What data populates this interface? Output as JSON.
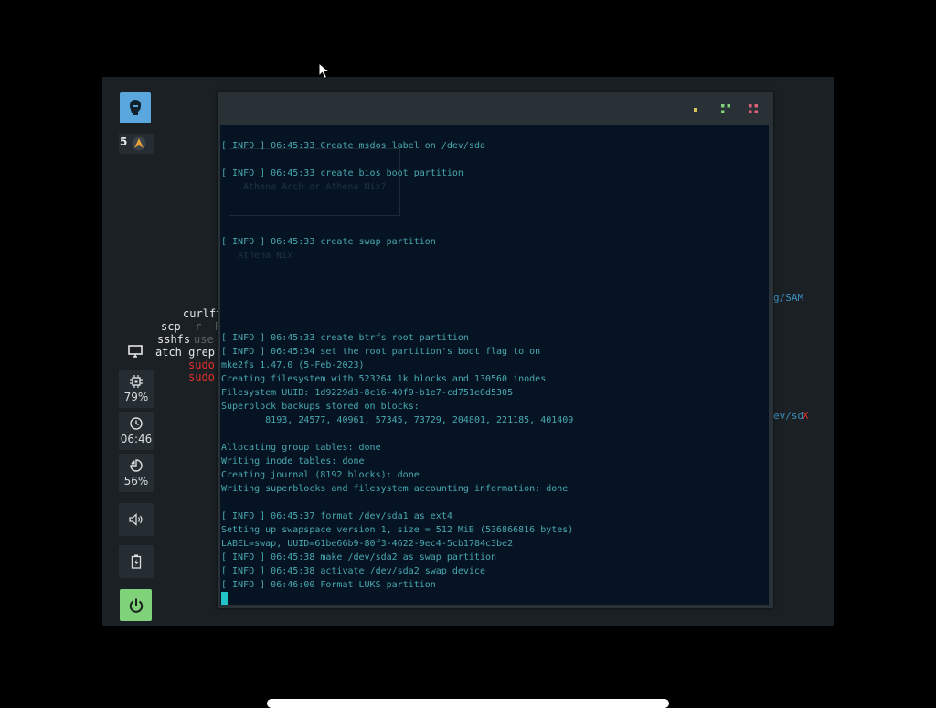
{
  "sidebar": {
    "workspace_number": "5",
    "cpu": "79%",
    "clock": "06:46",
    "memory": "56%",
    "logo_icon": "hacker-head-icon",
    "accent": "#5aa7de",
    "power_color": "#7fd17a"
  },
  "background_terminal": {
    "lines": [
      "curlft",
      "scp",
      "-r -P",
      "sshfs",
      "use",
      "atch grep",
      "sudo",
      "sudo"
    ],
    "right_fragments": [
      "g/SAM",
      "ev/sd",
      "X"
    ]
  },
  "ghost_menu": {
    "question": "Athena Arch or Athena Nix?",
    "option": "Athena Nix"
  },
  "terminal": {
    "lines": [
      "[ INFO ] 06:45:33 Create msdos label on /dev/sda",
      "[ INFO ] 06:45:33 create bios boot partition",
      "[ INFO ] 06:45:33 create swap partition",
      "[ INFO ] 06:45:33 create btrfs root partition",
      "[ INFO ] 06:45:34 set the root partition's boot flag to on",
      "mke2fs 1.47.0 (5-Feb-2023)",
      "Creating filesystem with 523264 1k blocks and 130560 inodes",
      "Filesystem UUID: 1d9229d3-8c16-40f9-b1e7-cd751e0d5305",
      "Superblock backups stored on blocks:",
      "        8193, 24577, 40961, 57345, 73729, 204801, 221185, 401409",
      "Allocating group tables: done",
      "Writing inode tables: done",
      "Creating journal (8192 blocks): done",
      "Writing superblocks and filesystem accounting information: done",
      "[ INFO ] 06:45:37 format /dev/sda1 as ext4",
      "Setting up swapspace version 1, size = 512 MiB (536866816 bytes)",
      "LABEL=swap, UUID=61be66b9-80f3-4622-9ec4-5cb1784c3be2",
      "[ INFO ] 06:45:38 make /dev/sda2 as swap partition",
      "[ INFO ] 06:45:38 activate /dev/sda2 swap device",
      "[ INFO ] 06:46:00 Format LUKS partition"
    ]
  }
}
